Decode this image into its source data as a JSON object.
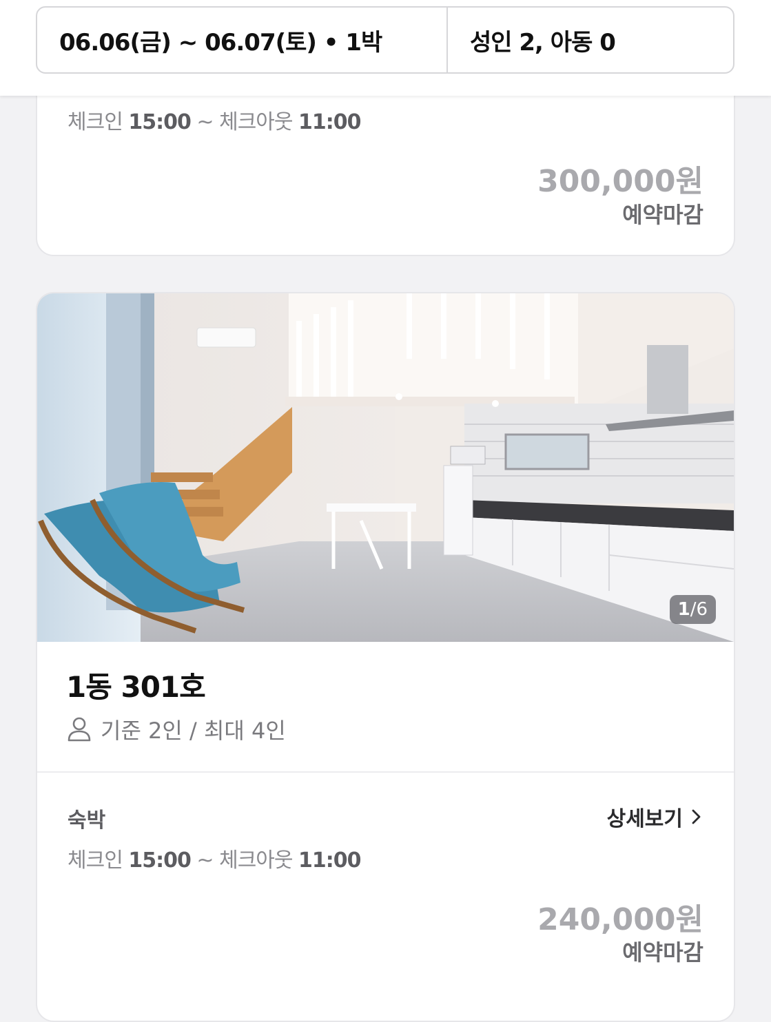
{
  "search": {
    "dates": "06.06(금) ~ 06.07(토) • 1박",
    "guests": "성인 2, 아동 0"
  },
  "rooms": [
    {
      "checkin_label": "체크인",
      "checkin_time": "15:00",
      "separator": "~",
      "checkout_label": "체크아웃",
      "checkout_time": "11:00",
      "price": "300,000원",
      "status": "예약마감"
    },
    {
      "photo_counter_current": "1",
      "photo_counter_total": "/6",
      "name": "1동 301호",
      "capacity": "기준 2인 / 최대 4인",
      "stay_type": "숙박",
      "detail_label": "상세보기",
      "checkin_label": "체크인",
      "checkin_time": "15:00",
      "separator": "~",
      "checkout_label": "체크아웃",
      "checkout_time": "11:00",
      "price": "240,000원",
      "status": "예약마감"
    }
  ],
  "icons": {
    "capacity": "person-icon",
    "detail": "chevron-right-icon"
  },
  "colors": {
    "price_closed": "#a9a9ad",
    "status_text": "#6b6b6f",
    "background": "#f2f2f4"
  }
}
